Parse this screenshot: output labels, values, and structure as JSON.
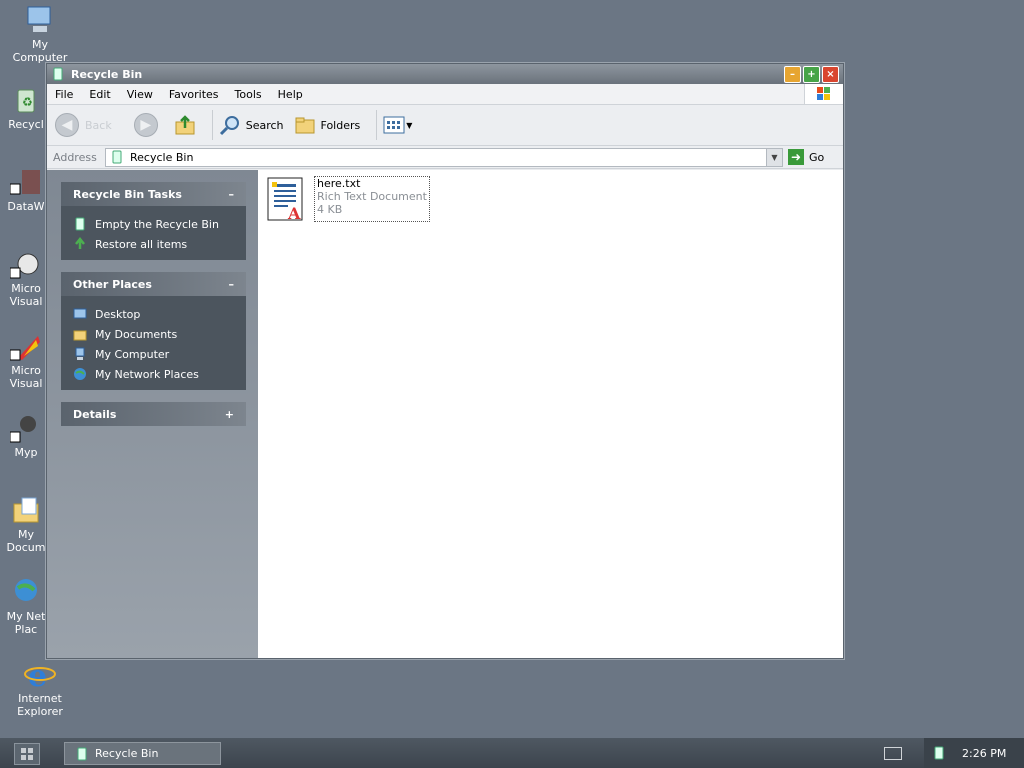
{
  "desktop": {
    "icons": [
      {
        "label": "My\nComputer"
      },
      {
        "label": "Recycl"
      },
      {
        "label": "DataW"
      },
      {
        "label": "Micro\nVisual"
      },
      {
        "label": "Micro\nVisual"
      },
      {
        "label": "Myp"
      },
      {
        "label": "My\nDocum"
      },
      {
        "label": "My Net\nPlac"
      },
      {
        "label": "Internet\nExplorer"
      }
    ]
  },
  "window": {
    "title": "Recycle Bin",
    "menu": [
      "File",
      "Edit",
      "View",
      "Favorites",
      "Tools",
      "Help"
    ],
    "toolbar": {
      "back_label": "Back",
      "search_label": "Search",
      "folders_label": "Folders"
    },
    "address": {
      "label": "Address",
      "value": "Recycle Bin",
      "go_label": "Go"
    },
    "tasks": {
      "title": "Recycle Bin Tasks",
      "items": [
        "Empty the Recycle Bin",
        "Restore all items"
      ]
    },
    "places": {
      "title": "Other Places",
      "items": [
        "Desktop",
        "My Documents",
        "My Computer",
        "My Network Places"
      ]
    },
    "details": {
      "title": "Details"
    },
    "files": [
      {
        "name": "here.txt",
        "type": "Rich Text Document",
        "size": "4 KB"
      }
    ]
  },
  "taskbar": {
    "task_label": "Recycle Bin",
    "clock": "2:26 PM"
  },
  "colors": {
    "desktop": "#6b7684",
    "panel_body": "#4c555e",
    "go_green": "#3a9a3a"
  }
}
